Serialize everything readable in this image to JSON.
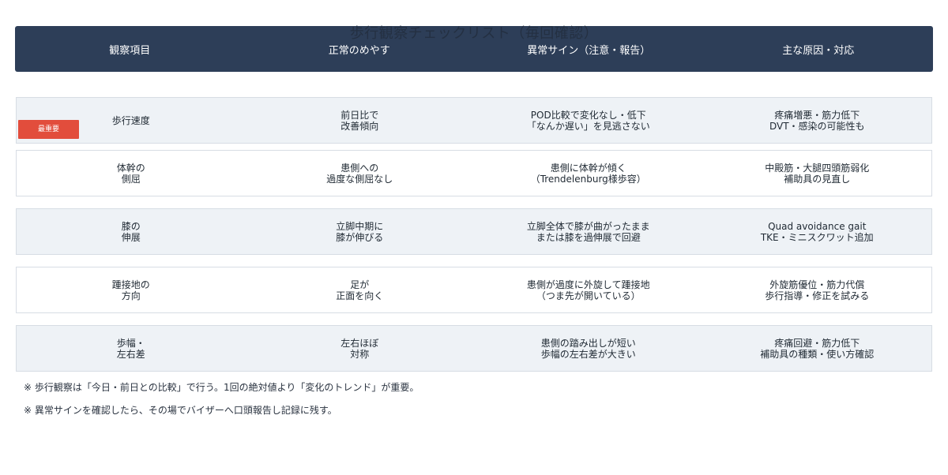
{
  "title": "歩行観察チェックリスト（毎回確認）",
  "header": {
    "columns": [
      "観察項目",
      "正常のめやす",
      "異常サイン（注意・報告）",
      "主な原因・対応"
    ]
  },
  "rows": [
    {
      "item": "歩行速度",
      "normal": "前日比で\n改善傾向",
      "abnormal": "POD比較で変化なし・低下\n「なんか遅い」を見逃さない",
      "cause": "疼痛増悪・筋力低下\nDVT・感染の可能性も",
      "badge": "最重要"
    },
    {
      "item": "体幹の\n側屈",
      "normal": "患側への\n過度な側屈なし",
      "abnormal": "患側に体幹が傾く\n（Trendelenburg様歩容）",
      "cause": "中殿筋・大腿四頭筋弱化\n補助具の見直し"
    },
    {
      "item": "膝の\n伸展",
      "normal": "立脚中期に\n膝が伸びる",
      "abnormal": "立脚全体で膝が曲がったまま\nまたは膝を過伸展で回避",
      "cause": "Quad avoidance gait\nTKE・ミニスクワット追加"
    },
    {
      "item": "踵接地の\n方向",
      "normal": "足が\n正面を向く",
      "abnormal": "患側が過度に外旋して踵接地\n（つま先が開いている）",
      "cause": "外旋筋優位・筋力代償\n歩行指導・修正を試みる"
    },
    {
      "item": "歩幅・\n左右差",
      "normal": "左右ほぼ\n対称",
      "abnormal": "患側の踏み出しが短い\n歩幅の左右差が大きい",
      "cause": "疼痛回避・筋力低下\n補助具の種類・使い方確認"
    }
  ],
  "notes": [
    "※ 歩行観察は「今日・前日との比較」で行う。1回の絶対値より「変化のトレンド」が重要。",
    "※ 異常サインを確認したら、その場でバイザーへ口頭報告し記録に残す。"
  ],
  "colors": {
    "header_bg": "#2d3e58",
    "row_shaded": "#eef2f6",
    "badge": "#e24d3c"
  }
}
